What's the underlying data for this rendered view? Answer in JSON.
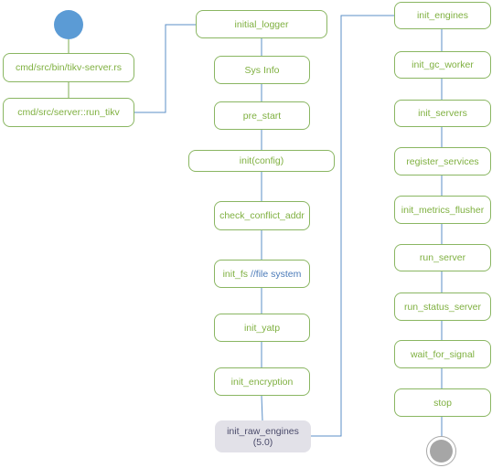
{
  "diagram": {
    "nodes": {
      "tikv_server_rs": "cmd/src/bin/tikv-server.rs",
      "run_tikv": "cmd/src/server::run_tikv",
      "initial_logger": "initial_logger",
      "sys_info": "Sys Info",
      "pre_start": "pre_start",
      "init_config": "init(config)",
      "check_conflict_addr": "check_conflict_addr",
      "init_fs": "init_fs",
      "init_fs_comment": " //file system",
      "init_yatp": "init_yatp",
      "init_encryption": "init_encryption",
      "init_raw_engines": "init_raw_engines",
      "init_raw_engines_version": "(5.0)",
      "init_engines": "init_engines",
      "init_gc_worker": "init_gc_worker",
      "init_servers": "init_servers",
      "register_services": "register_services",
      "init_metrics_flusher": "init_metrics_flusher",
      "run_server": "run_server",
      "run_status_server": "run_status_server",
      "wait_for_signal": "wait_for_signal",
      "stop": "stop"
    },
    "colors": {
      "node_border": "#8ab662",
      "node_text": "#7fb040",
      "connector": "#5b8fc7",
      "start_node": "#5b9bd5",
      "end_node": "#a6a6a6",
      "highlight_node": "#e2e1e8"
    }
  }
}
